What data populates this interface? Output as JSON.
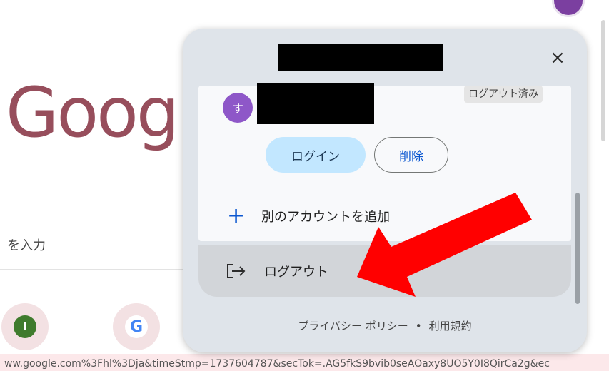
{
  "background": {
    "logo_text": "Goog",
    "search_placeholder": "を入力",
    "shortcuts": [
      {
        "letter": "I"
      },
      {
        "letter": "G"
      }
    ],
    "status_url": "ww.google.com%3Fhl%3Dja&timeStmp=1737604787&secTok=.AG5fkS9bvib0seAOaxy8UO5Y0I8QirCa2g&ec"
  },
  "popup": {
    "close_label": "×",
    "account": {
      "avatar_letter": "す",
      "status_badge": "ログアウト済み",
      "login_button": "ログイン",
      "delete_button": "削除"
    },
    "add_account": {
      "icon": "+",
      "label": "別のアカウントを追加"
    },
    "logout": {
      "label": "ログアウト"
    },
    "footer": {
      "privacy": "プライバシー ポリシー",
      "separator": "•",
      "terms": "利用規約"
    }
  },
  "colors": {
    "popup_bg": "#dfe4ea",
    "login_button_bg": "#c2e7ff",
    "accent_blue": "#0b57d0",
    "annotation_arrow": "#ff0000"
  }
}
